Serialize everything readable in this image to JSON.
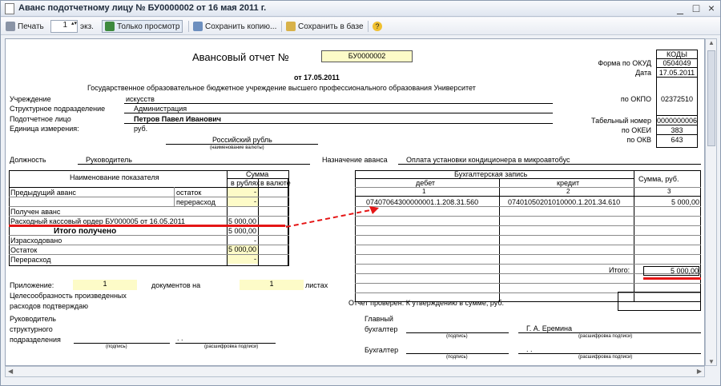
{
  "window": {
    "title": "Аванс подотчетному лицу № БУ0000002 от 16 мая 2011 г."
  },
  "toolbar": {
    "print": "Печать",
    "copies": "1",
    "copies_suffix": "экз.",
    "view_only": "Только просмотр",
    "save_copy": "Сохранить копию...",
    "save_db": "Сохранить в базе"
  },
  "report": {
    "title": "Авансовый отчет №",
    "number": "БУ0000002",
    "date": "от 17.05.2011",
    "codes_header": "КОДЫ",
    "form_label": "Форма по ОКУД",
    "form_code": "0504049",
    "date_label": "Дата",
    "date_code": "17.05.2011",
    "okpo_label": "по ОКПО",
    "okpo_code": "02372510",
    "tab_label": "Табельный номер",
    "tab_code": "0000000006",
    "okei_label": "по ОКЕИ",
    "okei_code": "383",
    "okv_label": "по ОКВ",
    "okv_code": "643",
    "org_label": "Учреждение",
    "org_line1": "Государственное образовательное бюджетное учреждение высшего профессионального образования  Университет",
    "org_line2": "искусств",
    "dept_label": "Структурное подразделение",
    "dept_value": "Администрация",
    "person_label": "Подотчетное лицо",
    "person_value": "Петров Павел Иванович",
    "unit_label": "Единица измерения:",
    "unit_value": "руб.",
    "currency_value": "Российский рубль",
    "currency_caption": "(наименование валюты)",
    "position_label": "Должность",
    "position_value": "Руководитель",
    "purpose_label": "Назначение аванса",
    "purpose_value": "Оплата установки кондиционера в микроавтобус"
  },
  "left_table": {
    "col_name": "Наименование показателя",
    "col_sum": "Сумма",
    "col_rub": "в рублях",
    "col_cur": "в валюте",
    "rows": [
      {
        "name": "Предыдущий аванс",
        "sub": "остаток",
        "rub": "-"
      },
      {
        "name": "",
        "sub": "перерасход",
        "rub": "-"
      },
      {
        "name": "Получен аванс",
        "sub": "",
        "rub": ""
      },
      {
        "name": "Расходный кассовый ордер БУ000005 от 16.05.2011",
        "sub": "",
        "rub": "5 000,00"
      },
      {
        "name": "Итого получено",
        "sub": "",
        "rub": "5 000,00"
      },
      {
        "name": "Израсходовано",
        "sub": "",
        "rub": "-"
      },
      {
        "name": "Остаток",
        "sub": "",
        "rub": "5 000,00"
      },
      {
        "name": "Перерасход",
        "sub": "",
        "rub": "-"
      }
    ]
  },
  "right_table": {
    "header": "Бухгалтерская запись",
    "debit": "дебет",
    "credit": "кредит",
    "sum": "Сумма, руб.",
    "n1": "1",
    "n2": "2",
    "n3": "3",
    "row_debit": "07407064300000001.1.208.31.560",
    "row_credit": "07401050201010000.1.201.34.610",
    "row_sum": "5 000,00",
    "total_label": "Итого:",
    "total_value": "5 000,00"
  },
  "footer": {
    "attach_label": "Приложение:",
    "attach_count": "1",
    "docs_label": "документов на",
    "sheets_count": "1",
    "sheets_label": "листах",
    "purpose1": "Целесообразность произведенных",
    "purpose2": "расходов подтверждаю",
    "checked": "Отчет проверен. К утверждению в сумме, руб.",
    "checked_value": "-",
    "head1": "Руководитель",
    "head2": "структурного",
    "head3": "подразделения",
    "dots": ". .",
    "sign_caption": "(подпись)",
    "decode_caption": "(расшифровка подписи)",
    "chief1": "Главный",
    "chief2": "бухгалтер",
    "chief_name": "Г. А. Еремина",
    "accountant": "Бухгалтер"
  }
}
